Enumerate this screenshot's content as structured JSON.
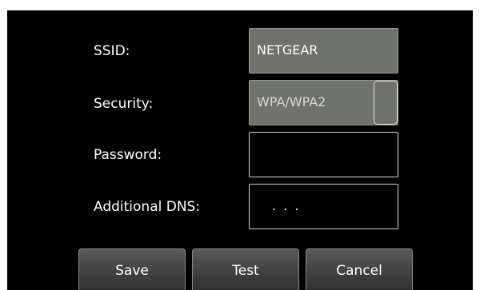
{
  "form": {
    "ssid_label": "SSID:",
    "ssid_value": "NETGEAR",
    "security_label": "Security:",
    "security_value": "WPA/WPA2",
    "password_label": "Password:",
    "password_value": "",
    "dns_label": "Additional DNS:",
    "dns_value": ". . ."
  },
  "buttons": {
    "save": "Save",
    "test": "Test",
    "cancel": "Cancel"
  },
  "colors": {
    "background": "#000000",
    "filled_field": "#6f716b",
    "text": "#ffffff"
  }
}
